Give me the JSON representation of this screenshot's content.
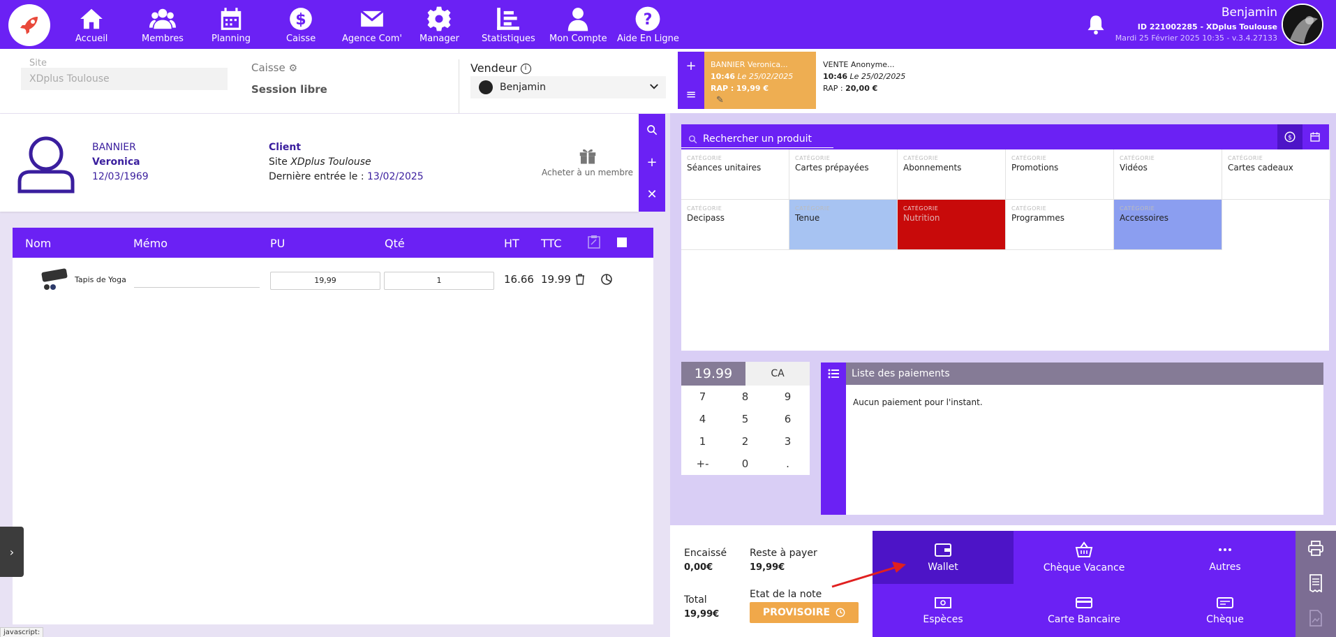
{
  "nav": {
    "items": [
      {
        "label": "Accueil",
        "icon": "home-icon"
      },
      {
        "label": "Membres",
        "icon": "users-icon"
      },
      {
        "label": "Planning",
        "icon": "calendar-icon"
      },
      {
        "label": "Caisse",
        "icon": "dollar-icon"
      },
      {
        "label": "Agence Com'",
        "icon": "mail-icon"
      },
      {
        "label": "Manager",
        "icon": "gear-icon"
      },
      {
        "label": "Statistiques",
        "icon": "chart-icon"
      },
      {
        "label": "Mon Compte",
        "icon": "user-icon"
      },
      {
        "label": "Aide En Ligne",
        "icon": "help-icon"
      }
    ],
    "user_name": "Benjamin",
    "user_id": "ID 221002285 - XDplus Toulouse",
    "user_date": "Mardi 25 Février 2025 10:35 - v.3.4.27133",
    "accent": "#6b21f4"
  },
  "context": {
    "site_label": "Site",
    "site_value": "XDplus Toulouse",
    "caisse_label": "Caisse",
    "caisse_value": "Session libre",
    "vendeur_label": "Vendeur",
    "vendeur_value": "Benjamin"
  },
  "tickets": [
    {
      "title": "BANNIER Veronica...",
      "time": "10:46",
      "date": "Le 25/02/2025",
      "rap_label": "RAP :",
      "rap_value": "19,99 €"
    },
    {
      "title": "VENTE Anonyme...",
      "time": "10:46",
      "date": "Le 25/02/2025",
      "rap_label": "RAP :",
      "rap_value": "20,00 €"
    }
  ],
  "client": {
    "last_name": "BANNIER",
    "first_name": "Veronica",
    "birth": "12/03/1969",
    "type": "Client",
    "site_prefix": "Site",
    "site": "XDplus Toulouse",
    "last_entry_label": "Dernière entrée le :",
    "last_entry": "13/02/2025",
    "gift_label": "Acheter à un membre"
  },
  "cart": {
    "columns": [
      "Nom",
      "Mémo",
      "PU",
      "Qté",
      "HT",
      "TTC"
    ],
    "rows": [
      {
        "name": "Tapis de Yoga",
        "pu": "19,99",
        "qty": "1",
        "ht": "16.66",
        "ttc": "19.99"
      }
    ]
  },
  "products": {
    "search_placeholder": "Rechercher un produit",
    "category_key": "CATÉGORIE",
    "categories": [
      {
        "name": "Séances unitaires",
        "color": "#ffffff"
      },
      {
        "name": "Cartes prépayées",
        "color": "#ffffff"
      },
      {
        "name": "Abonnements",
        "color": "#ffffff"
      },
      {
        "name": "Promotions",
        "color": "#ffffff"
      },
      {
        "name": "Vidéos",
        "color": "#ffffff"
      },
      {
        "name": "Cartes cadeaux",
        "color": "#ffffff"
      },
      {
        "name": "Decipass",
        "color": "#ffffff"
      },
      {
        "name": "Tenue",
        "color": "#a7c3f2"
      },
      {
        "name": "Nutrition",
        "color": "#c80a0a"
      },
      {
        "name": "Programmes",
        "color": "#ffffff"
      },
      {
        "name": "Accessoires",
        "color": "#8b9ef0"
      }
    ]
  },
  "keypad": {
    "total": "19.99",
    "ca": "CA",
    "keys": [
      "7",
      "8",
      "9",
      "4",
      "5",
      "6",
      "1",
      "2",
      "3",
      "+-",
      "0",
      "."
    ]
  },
  "payments": {
    "title": "Liste des paiements",
    "empty": "Aucun paiement pour l'instant."
  },
  "summary": {
    "encaisse_label": "Encaissé",
    "encaisse_value": "0,00€",
    "reste_label": "Reste à payer",
    "reste_value": "19,99€",
    "total_label": "Total",
    "total_value": "19,99€",
    "etat_label": "Etat de la note",
    "etat_value": "PROVISOIRE"
  },
  "pay_methods": [
    {
      "label": "Wallet",
      "icon": "wallet-icon"
    },
    {
      "label": "Chèque Vacance",
      "icon": "basket-icon"
    },
    {
      "label": "Autres",
      "icon": "more-icon"
    },
    {
      "label": "Espèces",
      "icon": "cash-icon"
    },
    {
      "label": "Carte Bancaire",
      "icon": "card-icon"
    },
    {
      "label": "Chèque",
      "icon": "cheque-icon"
    }
  ],
  "status_text": "javascript:"
}
